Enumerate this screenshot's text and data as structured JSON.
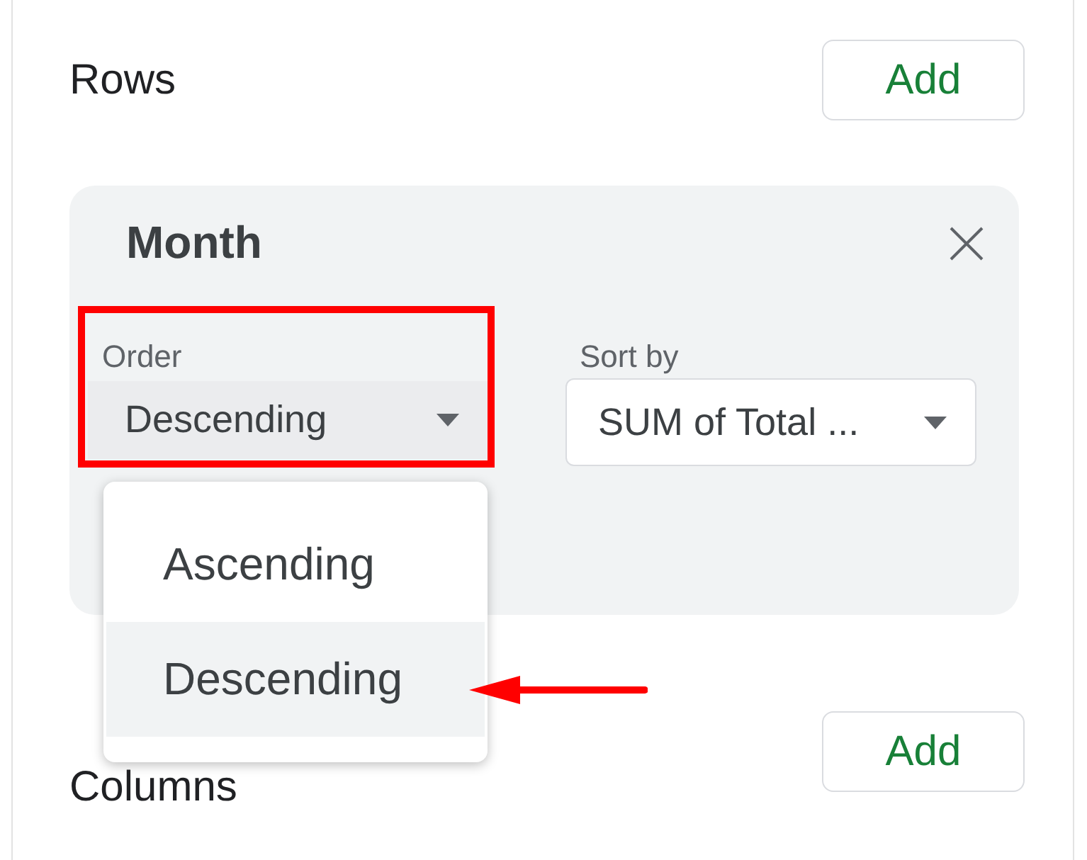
{
  "rows_section": {
    "title": "Rows",
    "add_button": "Add"
  },
  "row_card": {
    "title": "Month",
    "order": {
      "label": "Order",
      "value": "Descending"
    },
    "sort_by": {
      "label": "Sort by",
      "value": "SUM of Total ..."
    }
  },
  "order_menu": {
    "items": [
      {
        "label": "Ascending",
        "selected": false
      },
      {
        "label": "Descending",
        "selected": true
      }
    ]
  },
  "columns_section": {
    "title": "Columns",
    "add_button": "Add"
  }
}
